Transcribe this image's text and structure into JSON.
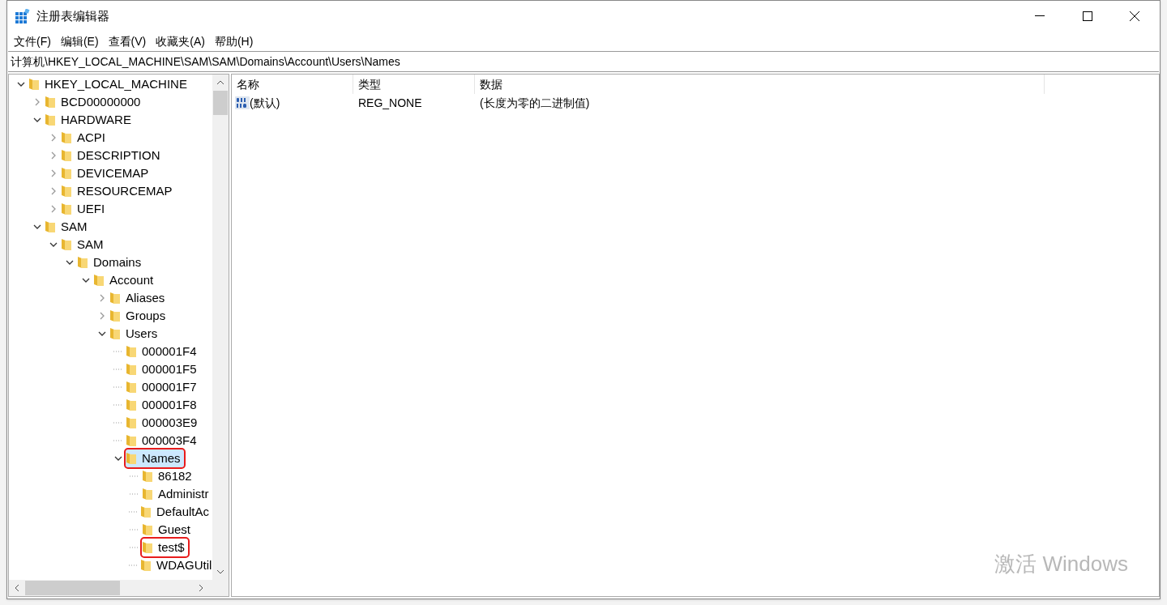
{
  "window": {
    "title": "注册表编辑器"
  },
  "menu": [
    {
      "label": "文件(F)"
    },
    {
      "label": "编辑(E)"
    },
    {
      "label": "查看(V)"
    },
    {
      "label": "收藏夹(A)"
    },
    {
      "label": "帮助(H)"
    }
  ],
  "address": {
    "value": "计算机\\HKEY_LOCAL_MACHINE\\SAM\\SAM\\Domains\\Account\\Users\\Names"
  },
  "tree": [
    {
      "label": "HKEY_LOCAL_MACHINE",
      "expanded": true,
      "selected": false,
      "highlighted": false,
      "children": [
        {
          "label": "BCD00000000",
          "expanded": false,
          "selected": false,
          "highlighted": false
        },
        {
          "label": "HARDWARE",
          "expanded": true,
          "selected": false,
          "highlighted": false,
          "children": [
            {
              "label": "ACPI",
              "expanded": false,
              "selected": false,
              "highlighted": false
            },
            {
              "label": "DESCRIPTION",
              "expanded": false,
              "selected": false,
              "highlighted": false
            },
            {
              "label": "DEVICEMAP",
              "expanded": false,
              "selected": false,
              "highlighted": false
            },
            {
              "label": "RESOURCEMAP",
              "expanded": false,
              "selected": false,
              "highlighted": false
            },
            {
              "label": "UEFI",
              "expanded": false,
              "selected": false,
              "highlighted": false
            }
          ]
        },
        {
          "label": "SAM",
          "expanded": true,
          "selected": false,
          "highlighted": false,
          "children": [
            {
              "label": "SAM",
              "expanded": true,
              "selected": false,
              "highlighted": false,
              "children": [
                {
                  "label": "Domains",
                  "expanded": true,
                  "selected": false,
                  "highlighted": false,
                  "children": [
                    {
                      "label": "Account",
                      "expanded": true,
                      "selected": false,
                      "highlighted": false,
                      "children": [
                        {
                          "label": "Aliases",
                          "expanded": false,
                          "selected": false,
                          "highlighted": false
                        },
                        {
                          "label": "Groups",
                          "expanded": false,
                          "selected": false,
                          "highlighted": false
                        },
                        {
                          "label": "Users",
                          "expanded": true,
                          "selected": false,
                          "highlighted": false,
                          "children": [
                            {
                              "label": "000001F4",
                              "selected": false,
                              "highlighted": false
                            },
                            {
                              "label": "000001F5",
                              "selected": false,
                              "highlighted": false
                            },
                            {
                              "label": "000001F7",
                              "selected": false,
                              "highlighted": false
                            },
                            {
                              "label": "000001F8",
                              "selected": false,
                              "highlighted": false
                            },
                            {
                              "label": "000003E9",
                              "selected": false,
                              "highlighted": false
                            },
                            {
                              "label": "000003F4",
                              "selected": false,
                              "highlighted": false
                            },
                            {
                              "label": "Names",
                              "expanded": true,
                              "selected": true,
                              "highlighted": true,
                              "children": [
                                {
                                  "label": "86182",
                                  "selected": false,
                                  "highlighted": false
                                },
                                {
                                  "label": "Administr",
                                  "selected": false,
                                  "highlighted": false
                                },
                                {
                                  "label": "DefaultAc",
                                  "selected": false,
                                  "highlighted": false
                                },
                                {
                                  "label": "Guest",
                                  "selected": false,
                                  "highlighted": false
                                },
                                {
                                  "label": "test$",
                                  "selected": false,
                                  "highlighted": true
                                },
                                {
                                  "label": "WDAGUtil",
                                  "selected": false,
                                  "highlighted": false
                                }
                              ]
                            }
                          ]
                        }
                      ]
                    }
                  ]
                }
              ]
            }
          ]
        }
      ]
    }
  ],
  "values_table": {
    "columns": [
      "名称",
      "类型",
      "数据"
    ],
    "rows": [
      {
        "name": "(默认)",
        "type": "REG_NONE",
        "data": "(长度为零的二进制值)"
      }
    ]
  },
  "activation_notice": "激活 Windows"
}
